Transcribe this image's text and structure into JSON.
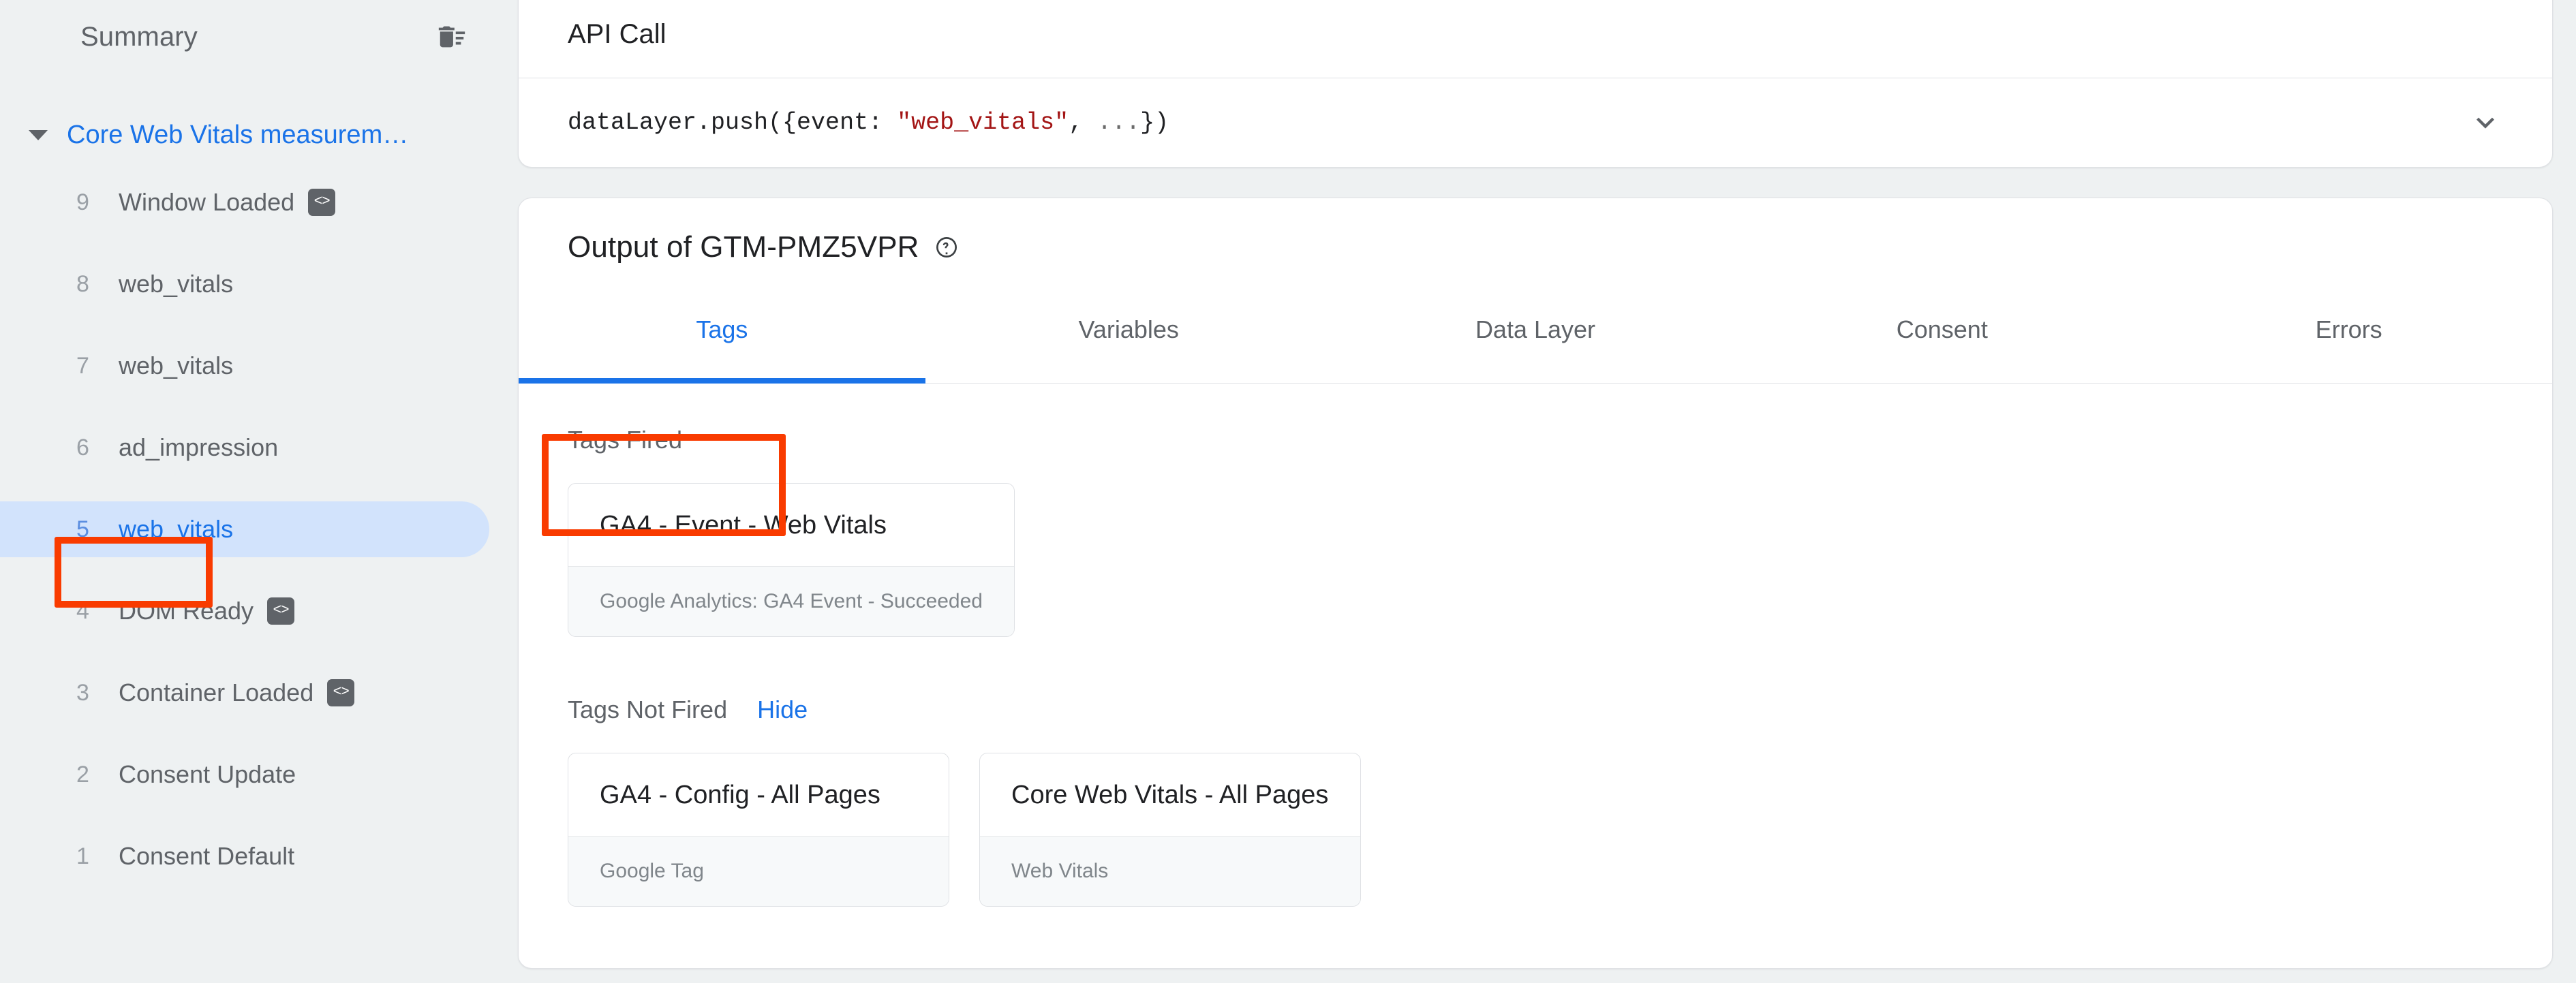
{
  "colors": {
    "accent": "#1a73e8",
    "annotation": "#f93b00",
    "selected_pill": "#d2e3fc",
    "page_bg": "#eef1f2",
    "text_primary": "#202124",
    "text_secondary": "#5f6368",
    "text_muted": "#80868b",
    "code_string": "#a31515"
  },
  "sidebar": {
    "title": "Summary",
    "clear_icon": "delete-sweep-icon",
    "group": {
      "caret_icon": "caret-down-icon",
      "label": "Core Web Vitals measurem…"
    },
    "events": [
      {
        "num": "9",
        "label": "Window Loaded",
        "has_code_badge": true,
        "code_badge": "<>",
        "selected": false
      },
      {
        "num": "8",
        "label": "web_vitals",
        "has_code_badge": false,
        "code_badge": "",
        "selected": false
      },
      {
        "num": "7",
        "label": "web_vitals",
        "has_code_badge": false,
        "code_badge": "",
        "selected": false
      },
      {
        "num": "6",
        "label": "ad_impression",
        "has_code_badge": false,
        "code_badge": "",
        "selected": false
      },
      {
        "num": "5",
        "label": "web_vitals",
        "has_code_badge": false,
        "code_badge": "",
        "selected": true
      },
      {
        "num": "4",
        "label": "DOM Ready",
        "has_code_badge": true,
        "code_badge": "<>",
        "selected": false
      },
      {
        "num": "3",
        "label": "Container Loaded",
        "has_code_badge": true,
        "code_badge": "<>",
        "selected": false
      },
      {
        "num": "2",
        "label": "Consent Update",
        "has_code_badge": false,
        "code_badge": "",
        "selected": false
      },
      {
        "num": "1",
        "label": "Consent Default",
        "has_code_badge": false,
        "code_badge": "",
        "selected": false
      }
    ]
  },
  "api_call": {
    "title": "API Call",
    "code": {
      "prefix": "dataLayer.push({event: ",
      "string": "\"web_vitals\"",
      "comma": ", ",
      "dots": "...",
      "suffix": "})"
    },
    "expand_icon": "chevron-down-icon"
  },
  "output": {
    "title": "Output of GTM-PMZ5VPR",
    "help_icon": "help-circle-icon",
    "tabs": [
      {
        "label": "Tags",
        "active": true
      },
      {
        "label": "Variables",
        "active": false
      },
      {
        "label": "Data Layer",
        "active": false
      },
      {
        "label": "Consent",
        "active": false
      },
      {
        "label": "Errors",
        "active": false
      }
    ],
    "tags_fired": {
      "heading": "Tags Fired",
      "cards": [
        {
          "title": "GA4 - Event - Web Vitals",
          "status": "Google Analytics: GA4 Event - Succeeded"
        }
      ]
    },
    "tags_not_fired": {
      "heading": "Tags Not Fired",
      "toggle_label": "Hide",
      "cards": [
        {
          "title": "GA4 - Config - All Pages",
          "status": "Google Tag"
        },
        {
          "title": "Core Web Vitals - All Pages",
          "status": "Web Vitals"
        }
      ]
    }
  },
  "annotations": [
    {
      "name": "highlight-selected-event",
      "target": "sidebar event 5 web_vitals"
    },
    {
      "name": "highlight-tags-fired",
      "target": "Tags Fired section"
    }
  ]
}
